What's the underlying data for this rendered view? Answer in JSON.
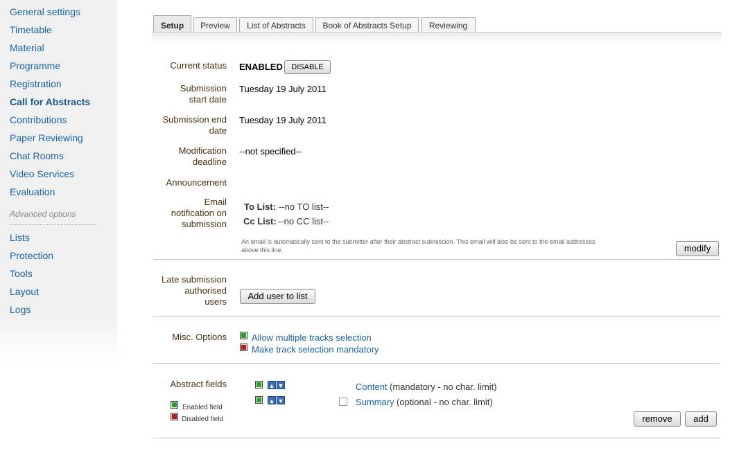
{
  "sidebar": {
    "items": [
      {
        "label": "General settings"
      },
      {
        "label": "Timetable"
      },
      {
        "label": "Material"
      },
      {
        "label": "Programme"
      },
      {
        "label": "Registration"
      },
      {
        "label": "Call for Abstracts"
      },
      {
        "label": "Contributions"
      },
      {
        "label": "Paper Reviewing"
      },
      {
        "label": "Chat Rooms"
      },
      {
        "label": "Video Services"
      },
      {
        "label": "Evaluation"
      }
    ],
    "advanced_label": "Advanced options",
    "advanced_items": [
      {
        "label": "Lists"
      },
      {
        "label": "Protection"
      },
      {
        "label": "Tools"
      },
      {
        "label": "Layout"
      },
      {
        "label": "Logs"
      }
    ]
  },
  "tabs": [
    {
      "label": "Setup"
    },
    {
      "label": "Preview"
    },
    {
      "label": "List of Abstracts"
    },
    {
      "label": "Book of Abstracts Setup"
    },
    {
      "label": "Reviewing"
    }
  ],
  "status": {
    "label": "Current status",
    "value": "ENABLED",
    "button": "DISABLE"
  },
  "start": {
    "label_1": "Submission",
    "label_2": "start date",
    "value": "Tuesday 19 July 2011"
  },
  "end": {
    "label_1": "Submission end",
    "label_2": "date",
    "value": "Tuesday 19 July 2011"
  },
  "modification": {
    "label_1": "Modification",
    "label_2": "deadline",
    "value": "--not specified--"
  },
  "announcement": {
    "label": "Announcement"
  },
  "email": {
    "label_1": "Email",
    "label_2": "notification on",
    "label_3": "submission",
    "to_label": "To List:",
    "to_value": "--no TO list--",
    "cc_label": "Cc List:",
    "cc_value": "--no CC list--",
    "note_1": "An email is automatically sent to the submitter after their abstract submission. This email will also be sent to the email addresses",
    "note_2": "above this line.",
    "modify_button": "modify"
  },
  "late": {
    "label_1": "Late submission",
    "label_2": "authorised",
    "label_3": "users",
    "button": "Add user to list"
  },
  "misc": {
    "label": "Misc. Options",
    "options": [
      {
        "label": "Allow multiple tracks selection",
        "state": "enabled"
      },
      {
        "label": "Make track selection mandatory",
        "state": "disabled"
      }
    ]
  },
  "abstract_fields": {
    "label": "Abstract fields",
    "legend_enabled": "Enabled field",
    "legend_disabled": "Disabled field",
    "fields": [
      {
        "name": "Content",
        "desc": "(mandatory - no char. limit)"
      },
      {
        "name": "Summary",
        "desc": "(optional - no char. limit)"
      }
    ],
    "remove_button": "remove",
    "add_button": "add"
  },
  "colors": {
    "link": "#1a64a0",
    "label": "#4a3210",
    "enabled": "#2e9e2e",
    "disabled": "#b02020"
  }
}
